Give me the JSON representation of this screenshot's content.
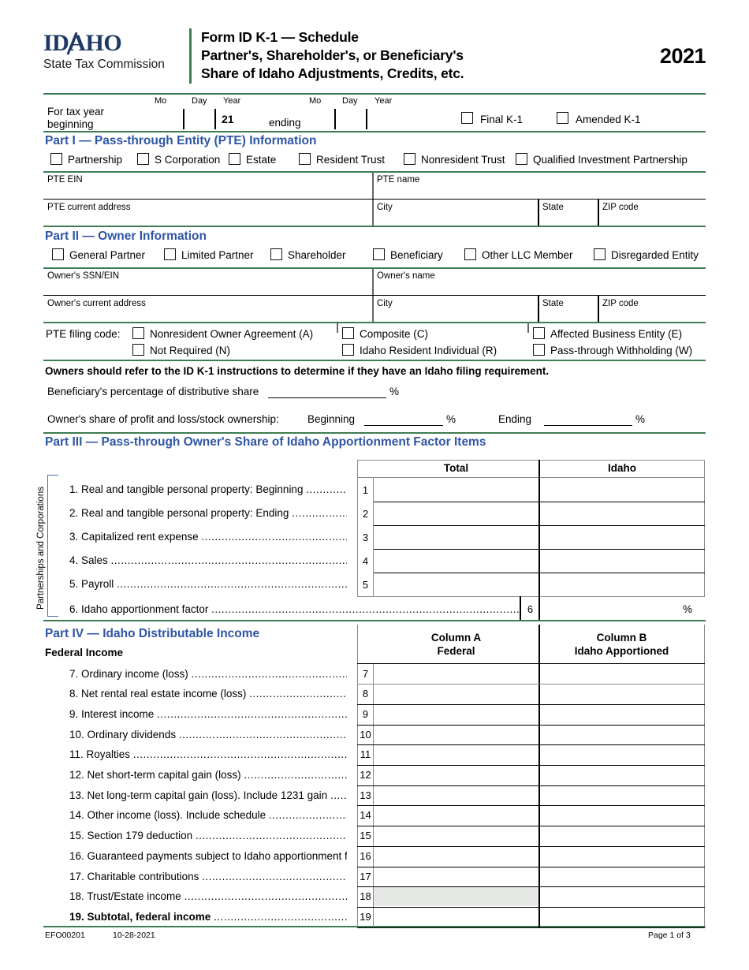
{
  "header": {
    "logo_main": "IDAHO",
    "logo_sub": "State Tax Commission",
    "title_line1": "Form ID K-1 — Schedule",
    "title_line2": "Partner's, Shareholder's, or Beneficiary's",
    "title_line3": "Share of Idaho Adjustments, Credits, etc.",
    "year": "2021",
    "brand_navy": "#1f3864",
    "brand_green": "#3f7d51",
    "heading_blue": "#2f55a4"
  },
  "taxyear": {
    "begin_label_1": "For tax year",
    "begin_label_2": "beginning",
    "mo": "Mo",
    "day": "Day",
    "year": "Year",
    "year_value": "21",
    "ending_label": "ending",
    "end_mo": "Mo",
    "end_day": "Day",
    "end_year": "Year",
    "final_k1": "Final K-1",
    "amended_k1": "Amended K-1"
  },
  "part1": {
    "heading": "Part I — Pass-through Entity (PTE) Information",
    "entity_types": [
      "Partnership",
      "S Corporation",
      "Estate",
      "Resident Trust",
      "Nonresident Trust",
      "Qualified Investment Partnership"
    ],
    "fields": {
      "ein": "PTE EIN",
      "name": "PTE name",
      "address": "PTE current address",
      "city": "City",
      "state": "State",
      "zip": "ZIP code"
    }
  },
  "part2": {
    "heading": "Part II — Owner Information",
    "owner_types": [
      "General Partner",
      "Limited Partner",
      "Shareholder",
      "Beneficiary",
      "Other LLC Member",
      "Disregarded Entity"
    ],
    "fields": {
      "ssn_ein": "Owner's SSN/EIN",
      "name": "Owner's name",
      "address": "Owner's current address",
      "city": "City",
      "state": "State",
      "zip": "ZIP code"
    },
    "filing_code_label": "PTE filing code:",
    "filing_codes": [
      "Nonresident Owner Agreement (A)",
      "Composite (C)",
      "Affected Business Entity (E)",
      "Not Required (N)",
      "Idaho Resident Individual (R)",
      "Pass-through Withholding (W)"
    ],
    "notice": "Owners should refer to the ID K-1 instructions to determine if they have an Idaho filing requirement.",
    "beneficiary_pct_label": "Beneficiary's percentage of distributive share",
    "pct_sign": "%",
    "ownership_label": "Owner's share of profit and loss/stock ownership:",
    "beginning_label": "Beginning",
    "ending_label": "Ending"
  },
  "part3": {
    "heading": "Part III — Pass-through Owner's Share of Idaho Apportionment Factor Items",
    "side_label": "Partnerships and Corporations",
    "col_total": "Total",
    "col_idaho": "Idaho",
    "rows": [
      {
        "no": "1",
        "label": "Real and tangible personal property: Beginning"
      },
      {
        "no": "2",
        "label": "Real and tangible personal property: Ending"
      },
      {
        "no": "3",
        "label": "Capitalized rent expense"
      },
      {
        "no": "4",
        "label": "Sales"
      },
      {
        "no": "5",
        "label": "Payroll"
      }
    ],
    "row6": {
      "no": "6",
      "label": "Idaho apportionment factor",
      "suffix": "%"
    }
  },
  "part4": {
    "heading": "Part IV — Idaho Distributable Income",
    "subheading": "Federal Income",
    "col_a_line1": "Column A",
    "col_a_line2": "Federal",
    "col_b_line1": "Column B",
    "col_b_line2": "Idaho Apportioned",
    "rows": [
      {
        "no": "7",
        "label": "Ordinary income (loss)",
        "bold": false,
        "shaded_a": false
      },
      {
        "no": "8",
        "label": "Net rental real estate income (loss)",
        "bold": false,
        "shaded_a": false
      },
      {
        "no": "9",
        "label": "Interest income",
        "bold": false,
        "shaded_a": false
      },
      {
        "no": "10",
        "label": "Ordinary dividends",
        "bold": false,
        "shaded_a": false
      },
      {
        "no": "11",
        "label": "Royalties",
        "bold": false,
        "shaded_a": false
      },
      {
        "no": "12",
        "label": "Net short-term capital gain (loss)",
        "bold": false,
        "shaded_a": false
      },
      {
        "no": "13",
        "label": "Net long-term capital gain (loss). Include 1231 gain",
        "bold": false,
        "shaded_a": false
      },
      {
        "no": "14",
        "label": "Other income (loss). Include schedule",
        "bold": false,
        "shaded_a": false
      },
      {
        "no": "15",
        "label": "Section 179 deduction",
        "bold": false,
        "shaded_a": false
      },
      {
        "no": "16",
        "label": "Guaranteed payments subject to Idaho apportionment factor",
        "bold": false,
        "shaded_a": false
      },
      {
        "no": "17",
        "label": "Charitable contributions",
        "bold": false,
        "shaded_a": false
      },
      {
        "no": "18",
        "label": "Trust/Estate income",
        "bold": false,
        "shaded_a": true
      },
      {
        "no": "19",
        "label": "Subtotal, federal income",
        "bold": true,
        "shaded_a": false
      }
    ]
  },
  "footer": {
    "form_id": "EFO00201",
    "revision_date": "10-28-2021",
    "page": "Page 1 of 3"
  }
}
